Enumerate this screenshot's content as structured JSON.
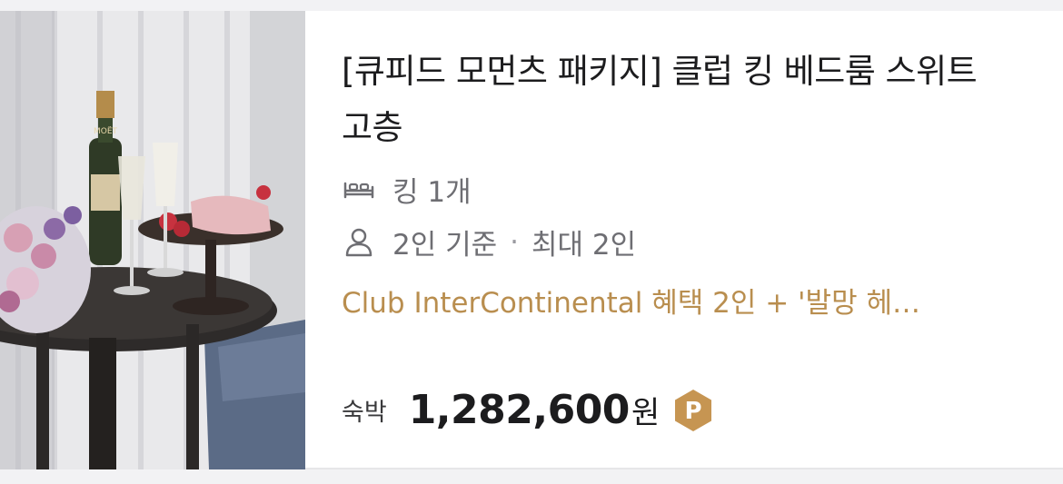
{
  "room": {
    "title": "[큐피드 모먼츠 패키지] 클럽 킹 베드룸 스위트 고층",
    "bed": "킹 1개",
    "guests_standard": "2인 기준",
    "separator": "·",
    "guests_max": "최대 2인",
    "benefit": "Club InterContinental 혜택 2인 + '발망 헤…"
  },
  "price": {
    "label": "숙박",
    "amount": "1,282,600",
    "unit": "원",
    "badge": "P"
  },
  "colors": {
    "benefit": "#b98e4f",
    "badge": "#c69552",
    "muted": "#6e6e73"
  },
  "icons": [
    "bed-icon",
    "person-icon",
    "point-badge-icon"
  ],
  "image": {
    "bottle_label": "MOËT"
  }
}
